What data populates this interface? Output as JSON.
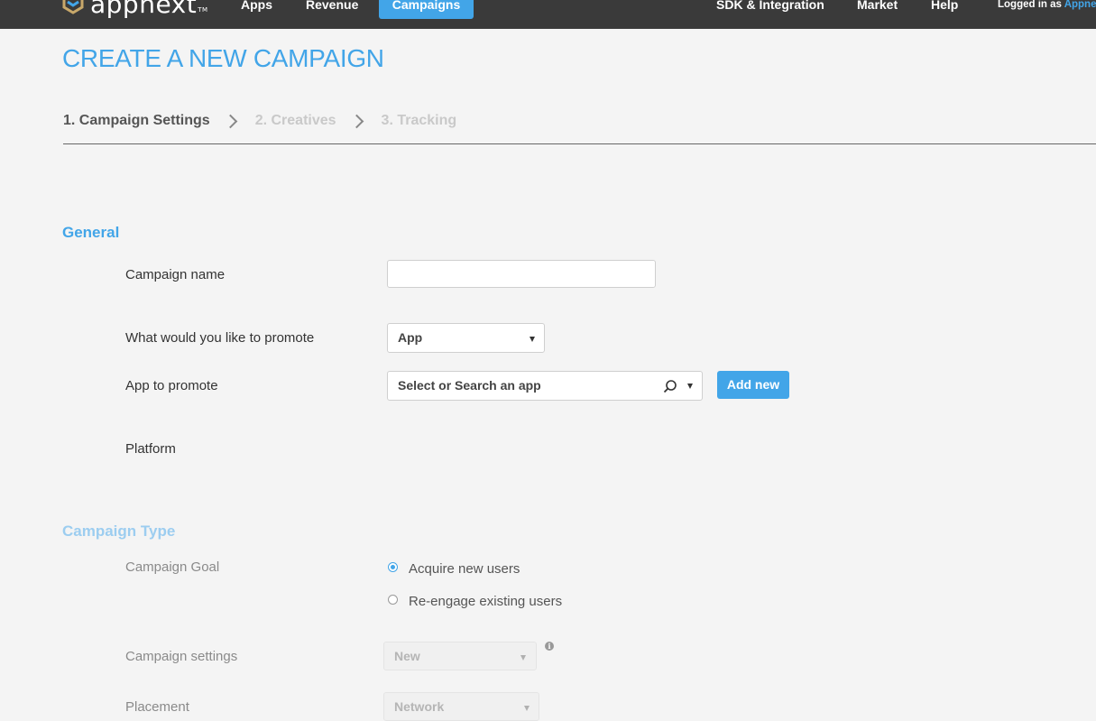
{
  "header": {
    "logo_text": "appnext",
    "logo_tm": "TM",
    "nav": [
      "Apps",
      "Revenue",
      "Campaigns",
      "SDK & Integration",
      "Market",
      "Help"
    ],
    "active_nav": "Campaigns",
    "login_prefix": "Logged in as",
    "login_user": "Appne"
  },
  "page": {
    "title": "CREATE A NEW CAMPAIGN",
    "steps": [
      "1. Campaign Settings",
      "2. Creatives",
      "3. Tracking"
    ]
  },
  "general": {
    "title": "General",
    "campaign_name_label": "Campaign name",
    "campaign_name_value": "",
    "promote_label": "What would you like to promote",
    "promote_value": "App",
    "app_label": "App to promote",
    "app_placeholder": "Select or Search an app",
    "add_new": "Add new",
    "platform_label": "Platform"
  },
  "campaign_type": {
    "title": "Campaign Type",
    "goal_label": "Campaign Goal",
    "goal_options": [
      "Acquire new users",
      "Re-engage existing users"
    ],
    "goal_selected": "Acquire new users",
    "settings_label": "Campaign settings",
    "settings_value": "New",
    "placement_label": "Placement",
    "placement_value": "Network"
  },
  "colors": {
    "accent": "#42a5e8",
    "topbar": "#3a3a3a",
    "background": "#f4f4f4"
  }
}
